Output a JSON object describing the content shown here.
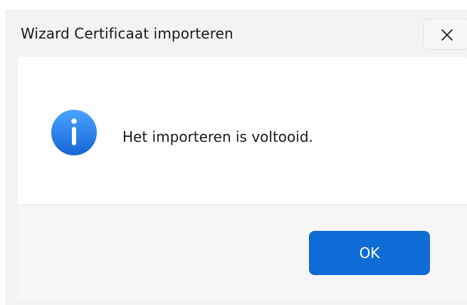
{
  "dialog": {
    "title": "Wizard Certificaat importeren",
    "message": "Het importeren is voltooid.",
    "ok_label": "OK",
    "close_icon": "close-icon",
    "info_icon": "info-icon"
  },
  "colors": {
    "accent": "#0f6cd6",
    "info_icon_top": "#4aa3ff",
    "info_icon_bottom": "#1565d8",
    "background": "#f3f3f3",
    "content": "#ffffff"
  }
}
